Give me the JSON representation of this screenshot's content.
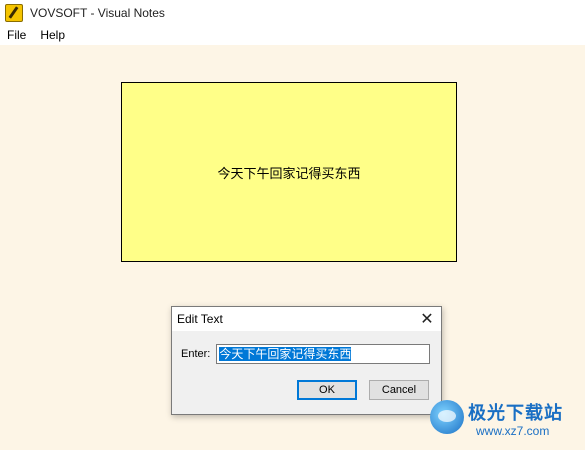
{
  "window": {
    "title": "VOVSOFT - Visual Notes"
  },
  "menu": {
    "items": [
      "File",
      "Help"
    ]
  },
  "note": {
    "text": "今天下午回家记得买东西"
  },
  "dialog": {
    "title": "Edit Text",
    "label": "Enter:",
    "value": "今天下午回家记得买东西",
    "ok_label": "OK",
    "cancel_label": "Cancel"
  },
  "watermark": {
    "brand": "极光下载站",
    "url": "www.xz7.com"
  },
  "colors": {
    "workspace": "#fdf5e6",
    "note": "#ffff88",
    "selection": "#0078d7"
  }
}
